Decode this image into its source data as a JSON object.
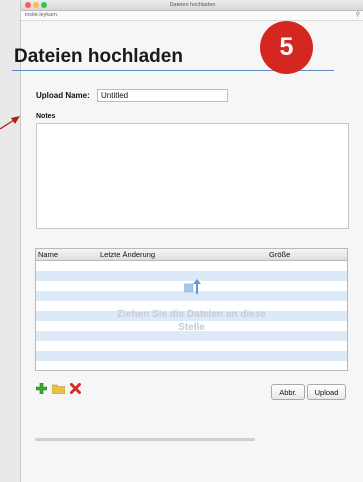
{
  "window": {
    "title": "Dateien hochladen",
    "url": "insite.leykam."
  },
  "page": {
    "heading": "Dateien hochladen",
    "badge": "5"
  },
  "form": {
    "upload_name_label": "Upload Name:",
    "upload_name_value": "Untitled",
    "notes_label": "Notes"
  },
  "table": {
    "columns": [
      "Name",
      "Letzte Änderung",
      "Größe"
    ],
    "drop_hint_line1": "Ziehen Sie die Dateien an diese",
    "drop_hint_line2": "Stelle"
  },
  "buttons": {
    "cancel": "Abbr.",
    "upload": "Upload"
  },
  "icons": {
    "add": "plus-icon",
    "folder": "folder-icon",
    "remove": "delete-x-icon"
  },
  "colors": {
    "badge": "#d3271f",
    "heading_rule": "#5c8cc4",
    "row_stripe": "#dce9f7"
  }
}
